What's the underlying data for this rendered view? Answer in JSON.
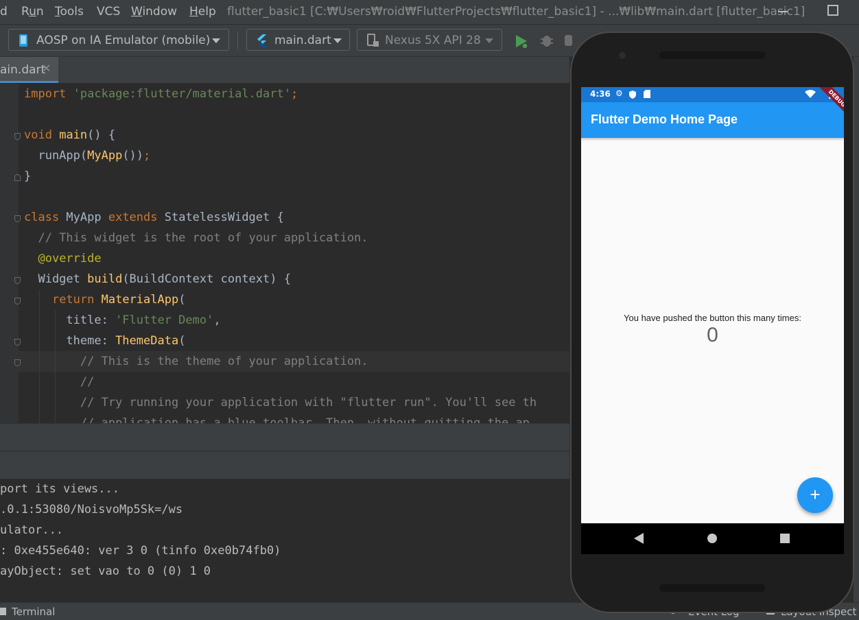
{
  "menubar": {
    "items": [
      "d",
      "Run",
      "Tools",
      "VCS",
      "Window",
      "Help"
    ],
    "underline": [
      "",
      "u",
      "T",
      "",
      "W",
      "H"
    ],
    "title": "flutter_basic1 [C:₩Users₩roid₩FlutterProjects₩flutter_basic1] - ...₩lib₩main.dart [flutter_basic1]"
  },
  "toolbar": {
    "device_selector": "AOSP on IA Emulator (mobile)",
    "run_config": "main.dart",
    "avd_selector": "Nexus 5X API 28"
  },
  "tabs": [
    {
      "label": "ain.dart"
    }
  ],
  "editor": {
    "lines": [
      "import 'package:flutter/material.dart';",
      "",
      "void main() {",
      "  runApp(MyApp());",
      "}",
      "",
      "class MyApp extends StatelessWidget {",
      "  // This widget is the root of your application.",
      "  @override",
      "  Widget build(BuildContext context) {",
      "    return MaterialApp(",
      "      title: 'Flutter Demo',",
      "      theme: ThemeData(",
      "        // This is the theme of your application.",
      "        //",
      "        // Try running your application with \"flutter run\". You'll see th",
      "        // application has a blue toolbar. Then, without quitting the ap"
    ]
  },
  "console": {
    "lines": [
      "port its views...",
      ".0.1:53080/NoisvoMp5Sk=/ws",
      "ulator...",
      ": 0xe455e640: ver 3 0 (tinfo 0xe0b74fb0)",
      "ayObject: set vao to 0 (0) 1 0"
    ]
  },
  "statusbar": {
    "terminal": "Terminal",
    "event_log": "Event Log",
    "layout_inspector": "Layout Inspect"
  },
  "phone": {
    "status_time": "4:36",
    "app_title": "Flutter Demo Home Page",
    "debug_banner": "DEBUG",
    "message": "You have pushed the button this many times:",
    "counter": "0",
    "fab_symbol": "+"
  },
  "colors": {
    "accent": "#2196f3",
    "status_bar": "#1976d2",
    "keyword": "#cc7832",
    "string": "#6a8759",
    "comment": "#808080"
  }
}
